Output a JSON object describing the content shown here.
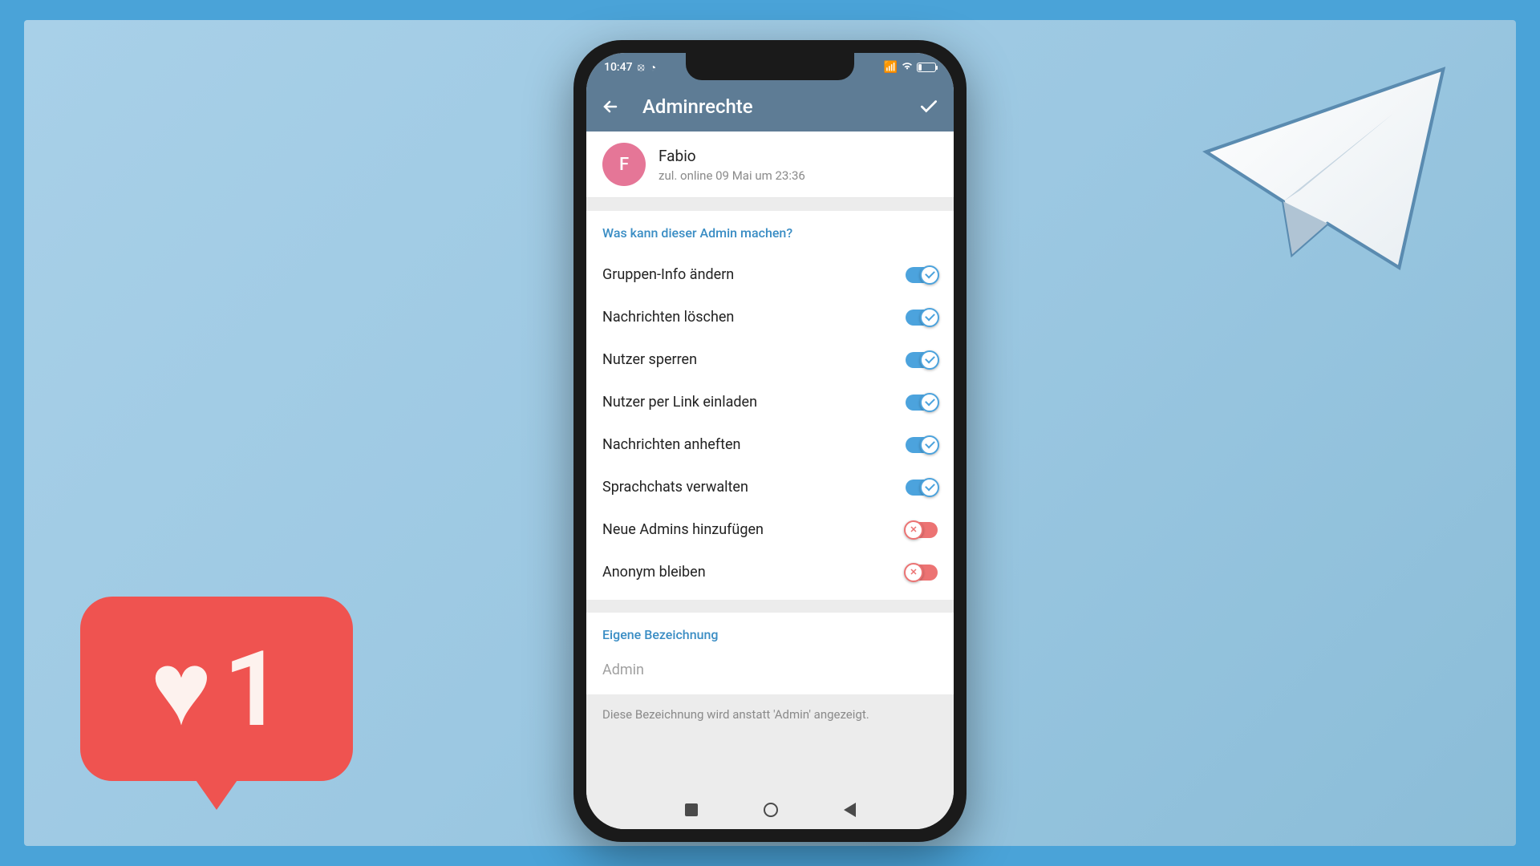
{
  "status_bar": {
    "time": "10:47",
    "battery_percent": "14"
  },
  "header": {
    "title": "Adminrechte"
  },
  "user": {
    "initial": "F",
    "name": "Fabio",
    "status": "zul. online 09 Mai um 23:36"
  },
  "permissions": {
    "section_title": "Was kann dieser Admin machen?",
    "items": [
      {
        "label": "Gruppen-Info ändern",
        "enabled": true
      },
      {
        "label": "Nachrichten löschen",
        "enabled": true
      },
      {
        "label": "Nutzer sperren",
        "enabled": true
      },
      {
        "label": "Nutzer per Link einladen",
        "enabled": true
      },
      {
        "label": "Nachrichten anheften",
        "enabled": true
      },
      {
        "label": "Sprachchats verwalten",
        "enabled": true
      },
      {
        "label": "Neue Admins hinzufügen",
        "enabled": false
      },
      {
        "label": "Anonym bleiben",
        "enabled": false
      }
    ]
  },
  "custom_title": {
    "section_title": "Eigene Bezeichnung",
    "placeholder": "Admin",
    "hint": "Diese Bezeichnung wird anstatt 'Admin' angezeigt."
  },
  "decorations": {
    "like_count": "1"
  }
}
